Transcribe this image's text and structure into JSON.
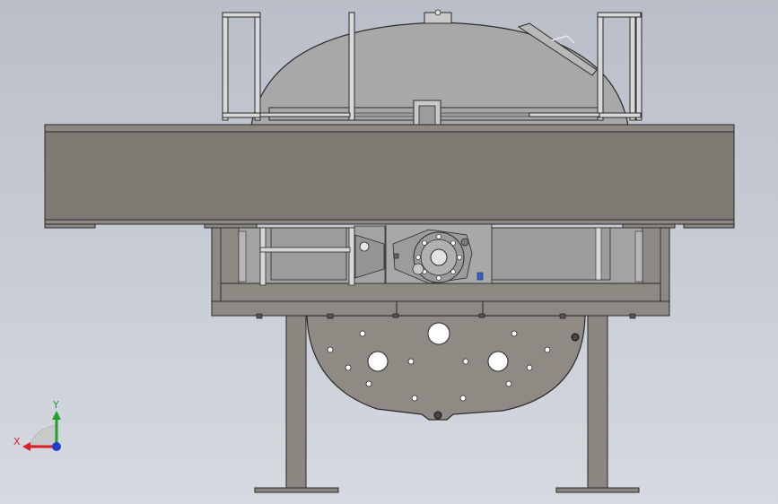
{
  "viewport": {
    "background_top": "#b9bec9",
    "background_bottom": "#d6d9e0"
  },
  "model": {
    "view": "front",
    "colors": {
      "body_fill": "#a9a9a9",
      "beam_fill": "#7f7b74",
      "frame_fill": "#8e8a83",
      "rail_fill": "#d6d6d6",
      "edge_stroke": "#2a2a2a"
    }
  },
  "triad": {
    "x_label": "X",
    "y_label": "Y",
    "x_color": "#d8202a",
    "y_color": "#22a02a",
    "z_color": "#1f3ec9"
  }
}
